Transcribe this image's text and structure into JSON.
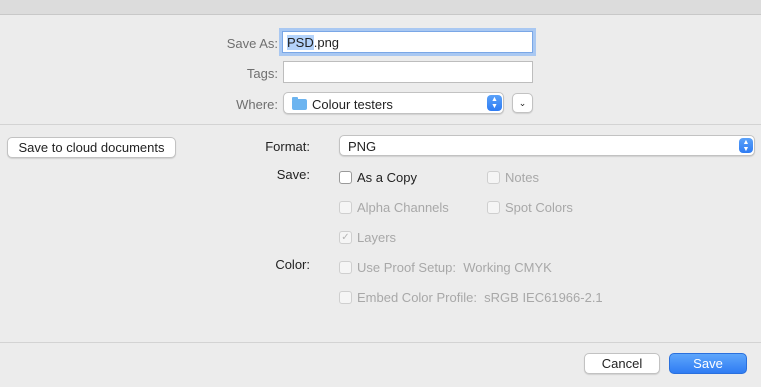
{
  "top": {
    "save_as_label": "Save As:",
    "filename_selected": "PSD",
    "filename_rest": ".png",
    "tags_label": "Tags:",
    "tags_value": "",
    "where_label": "Where:",
    "where_value": "Colour testers",
    "where_icon": "folder-icon",
    "expand_icon": "chevron-down-icon"
  },
  "cloud_button": "Save to cloud documents",
  "options": {
    "format_label": "Format:",
    "format_value": "PNG",
    "save_label": "Save:",
    "color_label": "Color:",
    "checkboxes": [
      {
        "label": "As a Copy",
        "checked": false,
        "enabled": true
      },
      {
        "label": "Notes",
        "checked": false,
        "enabled": false
      },
      {
        "label": "Alpha Channels",
        "checked": false,
        "enabled": false
      },
      {
        "label": "Spot Colors",
        "checked": false,
        "enabled": false
      },
      {
        "label": "Layers",
        "checked": true,
        "enabled": false
      },
      {
        "label": "Use Proof Setup:  Working CMYK",
        "checked": false,
        "enabled": false
      },
      {
        "label": "Embed Color Profile:  sRGB IEC61966-2.1",
        "checked": false,
        "enabled": false
      }
    ]
  },
  "footer": {
    "cancel": "Cancel",
    "save": "Save"
  },
  "colors": {
    "accent": "#2f7cf3",
    "folder": "#6cb4f0",
    "selection": "#b4d3fb"
  }
}
